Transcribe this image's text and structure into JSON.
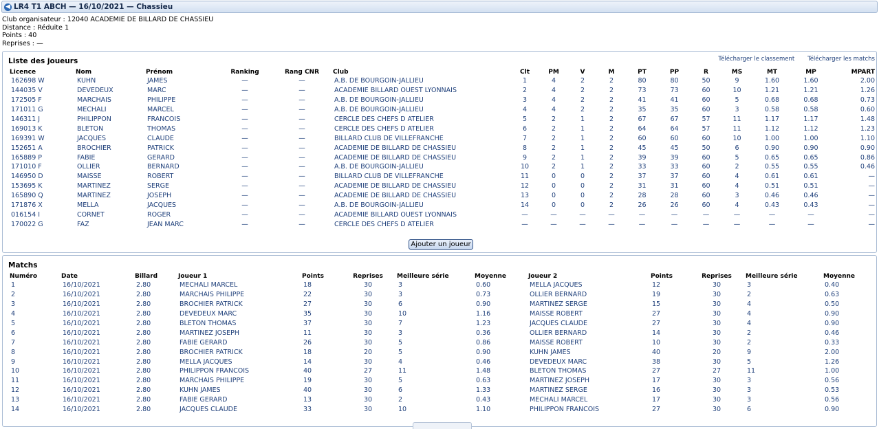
{
  "header": {
    "title": "LR4 T1 ABCH — 16/10/2021 — Chassieu"
  },
  "info": {
    "club_label": "Club organisateur : 12040 ACADEMIE DE BILLARD DE CHASSIEU",
    "distance_label": "Distance : Réduite 1",
    "points_label": "Points : 40",
    "reprises_label": "Reprises : —"
  },
  "players": {
    "title": "Liste des joueurs",
    "download_ranking": "Télécharger le classement",
    "download_matches": "Télécharger les matchs",
    "add_button": "Ajouter un joueur",
    "headers": [
      "Licence",
      "Nom",
      "Prénom",
      "Ranking",
      "Rang CNR",
      "Club",
      "Clt",
      "PM",
      "V",
      "M",
      "PT",
      "PP",
      "R",
      "MS",
      "MT",
      "MP",
      "MPART"
    ],
    "rows": [
      [
        "162698 W",
        "KUHN",
        "JAMES",
        "—",
        "—",
        "A.B. DE BOURGOIN-JALLIEU",
        "1",
        "4",
        "2",
        "2",
        "80",
        "80",
        "50",
        "9",
        "1.60",
        "1.60",
        "2.00"
      ],
      [
        "144035 V",
        "DEVEDEUX",
        "MARC",
        "—",
        "—",
        "ACADEMIE BILLARD OUEST LYONNAIS",
        "2",
        "4",
        "2",
        "2",
        "73",
        "73",
        "60",
        "10",
        "1.21",
        "1.21",
        "1.26"
      ],
      [
        "172505 F",
        "MARCHAIS",
        "PHILIPPE",
        "—",
        "—",
        "A.B. DE BOURGOIN-JALLIEU",
        "3",
        "4",
        "2",
        "2",
        "41",
        "41",
        "60",
        "5",
        "0.68",
        "0.68",
        "0.73"
      ],
      [
        "171011 G",
        "MECHALI",
        "MARCEL",
        "—",
        "—",
        "A.B. DE BOURGOIN-JALLIEU",
        "4",
        "4",
        "2",
        "2",
        "35",
        "35",
        "60",
        "3",
        "0.58",
        "0.58",
        "0.60"
      ],
      [
        "146311 J",
        "PHILIPPON",
        "FRANCOIS",
        "—",
        "—",
        "CERCLE DES CHEFS D ATELIER",
        "5",
        "2",
        "1",
        "2",
        "67",
        "67",
        "57",
        "11",
        "1.17",
        "1.17",
        "1.48"
      ],
      [
        "169013 K",
        "BLETON",
        "THOMAS",
        "—",
        "—",
        "CERCLE DES CHEFS D ATELIER",
        "6",
        "2",
        "1",
        "2",
        "64",
        "64",
        "57",
        "11",
        "1.12",
        "1.12",
        "1.23"
      ],
      [
        "169391 W",
        "JACQUES",
        "CLAUDE",
        "—",
        "—",
        "BILLARD CLUB DE VILLEFRANCHE",
        "7",
        "2",
        "1",
        "2",
        "60",
        "60",
        "60",
        "10",
        "1.00",
        "1.00",
        "1.10"
      ],
      [
        "152651 A",
        "BROCHIER",
        "PATRICK",
        "—",
        "—",
        "ACADEMIE DE BILLARD DE CHASSIEU",
        "8",
        "2",
        "1",
        "2",
        "45",
        "45",
        "50",
        "6",
        "0.90",
        "0.90",
        "0.90"
      ],
      [
        "165889 P",
        "FABIE",
        "GERARD",
        "—",
        "—",
        "ACADEMIE DE BILLARD DE CHASSIEU",
        "9",
        "2",
        "1",
        "2",
        "39",
        "39",
        "60",
        "5",
        "0.65",
        "0.65",
        "0.86"
      ],
      [
        "171010 F",
        "OLLIER",
        "BERNARD",
        "—",
        "—",
        "A.B. DE BOURGOIN-JALLIEU",
        "10",
        "2",
        "1",
        "2",
        "33",
        "33",
        "60",
        "2",
        "0.55",
        "0.55",
        "0.46"
      ],
      [
        "146950 D",
        "MAISSE",
        "ROBERT",
        "—",
        "—",
        "BILLARD CLUB DE VILLEFRANCHE",
        "11",
        "0",
        "0",
        "2",
        "37",
        "37",
        "60",
        "4",
        "0.61",
        "0.61",
        "—"
      ],
      [
        "153695 K",
        "MARTINEZ",
        "SERGE",
        "—",
        "—",
        "ACADEMIE DE BILLARD DE CHASSIEU",
        "12",
        "0",
        "0",
        "2",
        "31",
        "31",
        "60",
        "4",
        "0.51",
        "0.51",
        "—"
      ],
      [
        "165890 Q",
        "MARTINEZ",
        "JOSEPH",
        "—",
        "—",
        "ACADEMIE DE BILLARD DE CHASSIEU",
        "13",
        "0",
        "0",
        "2",
        "28",
        "28",
        "60",
        "3",
        "0.46",
        "0.46",
        "—"
      ],
      [
        "171876 X",
        "MELLA",
        "JACQUES",
        "—",
        "—",
        "A.B. DE BOURGOIN-JALLIEU",
        "14",
        "0",
        "0",
        "2",
        "26",
        "26",
        "60",
        "4",
        "0.43",
        "0.43",
        "—"
      ],
      [
        "016154 I",
        "CORNET",
        "ROGER",
        "—",
        "—",
        "ACADEMIE BILLARD OUEST LYONNAIS",
        "—",
        "—",
        "—",
        "—",
        "—",
        "—",
        "—",
        "—",
        "—",
        "—",
        "—"
      ],
      [
        "170022 G",
        "FAZ",
        "JEAN MARC",
        "—",
        "—",
        "CERCLE DES CHEFS D ATELIER",
        "—",
        "—",
        "—",
        "—",
        "—",
        "—",
        "—",
        "—",
        "—",
        "—",
        "—"
      ]
    ]
  },
  "matches": {
    "title": "Matchs",
    "headers": [
      "Numéro",
      "Date",
      "Billard",
      "Joueur 1",
      "Points",
      "Reprises",
      "Meilleure série",
      "Moyenne",
      "Joueur 2",
      "Points",
      "Reprises",
      "Meilleure série",
      "Moyenne"
    ],
    "rows": [
      [
        "1",
        "16/10/2021",
        "2.80",
        "MECHALI MARCEL",
        "18",
        "30",
        "3",
        "0.60",
        "MELLA JACQUES",
        "12",
        "30",
        "3",
        "0.40"
      ],
      [
        "2",
        "16/10/2021",
        "2.80",
        "MARCHAIS PHILIPPE",
        "22",
        "30",
        "3",
        "0.73",
        "OLLIER BERNARD",
        "19",
        "30",
        "2",
        "0.63"
      ],
      [
        "3",
        "16/10/2021",
        "2.80",
        "BROCHIER PATRICK",
        "27",
        "30",
        "6",
        "0.90",
        "MARTINEZ SERGE",
        "15",
        "30",
        "4",
        "0.50"
      ],
      [
        "4",
        "16/10/2021",
        "2.80",
        "DEVEDEUX MARC",
        "35",
        "30",
        "10",
        "1.16",
        "MAISSE ROBERT",
        "27",
        "30",
        "4",
        "0.90"
      ],
      [
        "5",
        "16/10/2021",
        "2.80",
        "BLETON THOMAS",
        "37",
        "30",
        "7",
        "1.23",
        "JACQUES CLAUDE",
        "27",
        "30",
        "4",
        "0.90"
      ],
      [
        "6",
        "16/10/2021",
        "2.80",
        "MARTINEZ JOSEPH",
        "11",
        "30",
        "3",
        "0.36",
        "OLLIER BERNARD",
        "14",
        "30",
        "2",
        "0.46"
      ],
      [
        "7",
        "16/10/2021",
        "2.80",
        "FABIE GERARD",
        "26",
        "30",
        "5",
        "0.86",
        "MAISSE ROBERT",
        "10",
        "30",
        "2",
        "0.33"
      ],
      [
        "8",
        "16/10/2021",
        "2.80",
        "BROCHIER PATRICK",
        "18",
        "20",
        "5",
        "0.90",
        "KUHN JAMES",
        "40",
        "20",
        "9",
        "2.00"
      ],
      [
        "9",
        "16/10/2021",
        "2.80",
        "MELLA JACQUES",
        "14",
        "30",
        "4",
        "0.46",
        "DEVEDEUX MARC",
        "38",
        "30",
        "5",
        "1.26"
      ],
      [
        "10",
        "16/10/2021",
        "2.80",
        "PHILIPPON FRANCOIS",
        "40",
        "27",
        "11",
        "1.48",
        "BLETON THOMAS",
        "27",
        "27",
        "11",
        "1.00"
      ],
      [
        "11",
        "16/10/2021",
        "2.80",
        "MARCHAIS PHILIPPE",
        "19",
        "30",
        "5",
        "0.63",
        "MARTINEZ JOSEPH",
        "17",
        "30",
        "3",
        "0.56"
      ],
      [
        "12",
        "16/10/2021",
        "2.80",
        "KUHN JAMES",
        "40",
        "30",
        "6",
        "1.33",
        "MARTINEZ SERGE",
        "16",
        "30",
        "3",
        "0.53"
      ],
      [
        "13",
        "16/10/2021",
        "2.80",
        "FABIE GERARD",
        "13",
        "30",
        "2",
        "0.43",
        "MECHALI MARCEL",
        "17",
        "30",
        "3",
        "0.56"
      ],
      [
        "14",
        "16/10/2021",
        "2.80",
        "JACQUES CLAUDE",
        "33",
        "30",
        "10",
        "1.10",
        "PHILIPPON FRANCOIS",
        "27",
        "30",
        "6",
        "0.90"
      ]
    ]
  }
}
